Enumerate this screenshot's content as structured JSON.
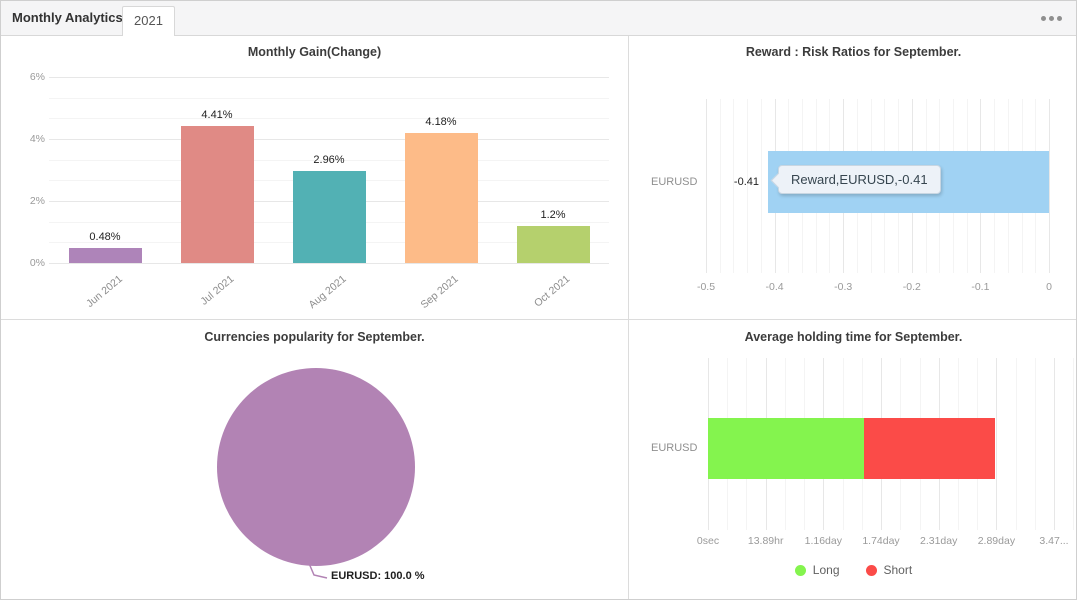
{
  "header": {
    "title": "Monthly Analytics",
    "active_tab": "2021",
    "menu_icon": "ellipsis-menu-icon"
  },
  "ui_colors": {
    "tabbar_background": "#f5f5f6",
    "panel_border": "#dcdcdc",
    "grid_major": "#e7e7e7",
    "grid_minor": "#f4f4f4",
    "axis_label": "#9a9a9a",
    "title_text": "#3c3c3c",
    "tooltip_background": "#edf2f8"
  },
  "chart_data": [
    {
      "type": "bar",
      "title": "Monthly Gain(Change)",
      "categories": [
        "Jun 2021",
        "Jul 2021",
        "Aug 2021",
        "Sep 2021",
        "Oct 2021"
      ],
      "values": [
        0.48,
        4.41,
        2.96,
        4.18,
        1.2
      ],
      "value_labels": [
        "0.48%",
        "4.41%",
        "2.96%",
        "4.18%",
        "1.2%"
      ],
      "bar_colors": [
        "#ae84b9",
        "#e08a85",
        "#52b1b4",
        "#fdbb88",
        "#b5d06d"
      ],
      "yticks": [
        {
          "label": "6%",
          "value": 6
        },
        {
          "label": "4%",
          "value": 4
        },
        {
          "label": "2%",
          "value": 2
        },
        {
          "label": "0%",
          "value": 0
        }
      ],
      "ylim": [
        0,
        6.45
      ],
      "grid": true,
      "legend_position": "none"
    },
    {
      "type": "bar",
      "orientation": "horizontal",
      "title": "Reward : Risk Ratios for September.",
      "categories": [
        "EURUSD"
      ],
      "values": [
        -0.41
      ],
      "value_labels": [
        "-0.41"
      ],
      "bar_color": "#a0d2f3",
      "xlim": [
        -0.5,
        0
      ],
      "xticks": [
        {
          "label": "-0.5",
          "value": -0.5
        },
        {
          "label": "-0.4",
          "value": -0.4
        },
        {
          "label": "-0.3",
          "value": -0.3
        },
        {
          "label": "-0.2",
          "value": -0.2
        },
        {
          "label": "-0.1",
          "value": -0.1
        },
        {
          "label": "0",
          "value": 0
        }
      ],
      "tooltip": {
        "text": "Reward,EURUSD,-0.41"
      },
      "grid": true,
      "legend_position": "none"
    },
    {
      "type": "pie",
      "title": "Currencies popularity for September.",
      "slices": [
        {
          "name": "EURUSD",
          "value": 100.0,
          "label": "EURUSD: 100.0 %",
          "color": "#b283b4"
        }
      ],
      "legend_position": "none"
    },
    {
      "type": "bar",
      "orientation": "horizontal-stacked",
      "title": "Average holding time for September.",
      "categories": [
        "EURUSD"
      ],
      "series": [
        {
          "name": "Long",
          "color": "#84f44e",
          "days": 1.57
        },
        {
          "name": "Short",
          "color": "#fb4b48",
          "days": 1.31
        }
      ],
      "xlim_days": [
        0,
        3.472
      ],
      "xticks": [
        {
          "label": "0sec",
          "days": 0
        },
        {
          "label": "13.89hr",
          "days": 0.579
        },
        {
          "label": "1.16day",
          "days": 1.157
        },
        {
          "label": "1.74day",
          "days": 1.736
        },
        {
          "label": "2.31day",
          "days": 2.315
        },
        {
          "label": "2.89day",
          "days": 2.894
        },
        {
          "label": "3.47...",
          "days": 3.472
        }
      ],
      "grid": true,
      "legend_position": "bottom"
    }
  ]
}
